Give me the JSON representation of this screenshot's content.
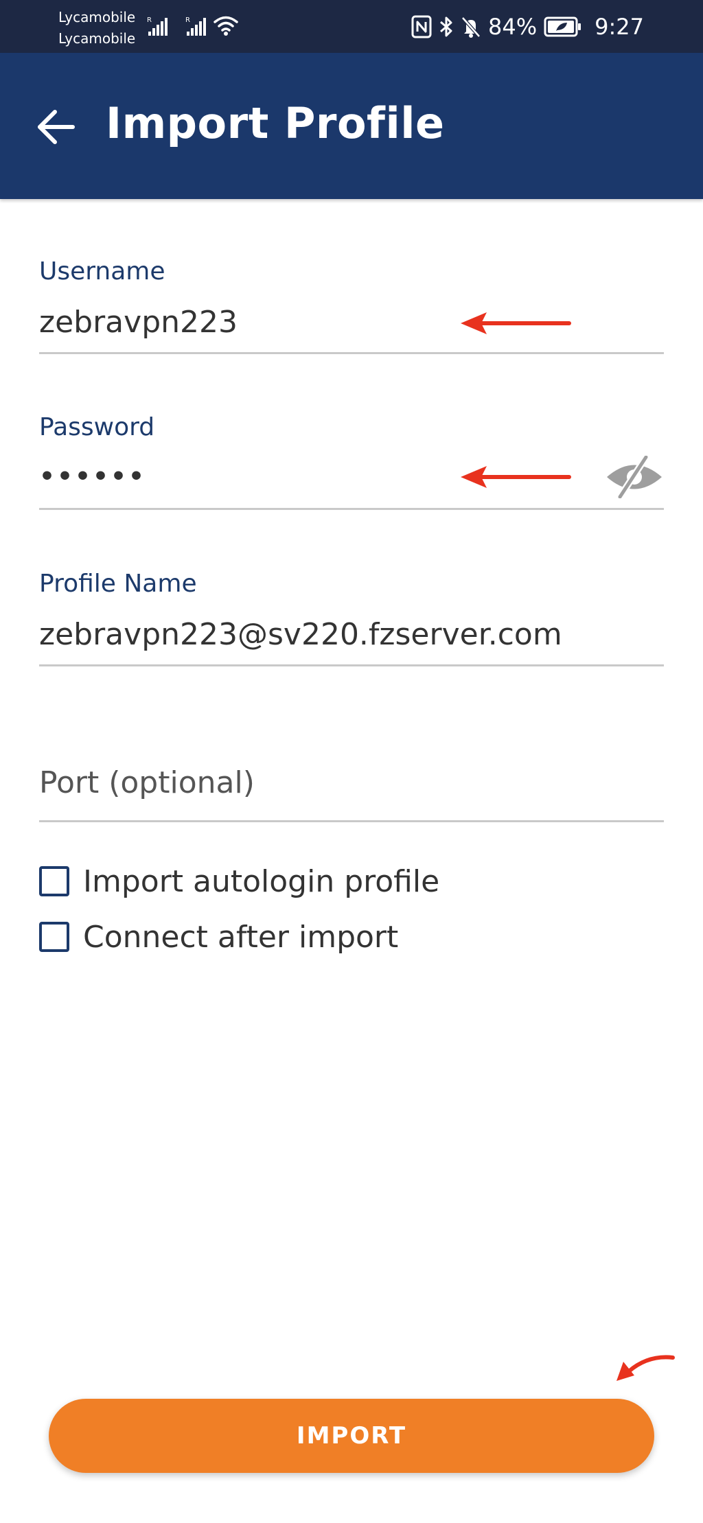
{
  "status_bar": {
    "carrier_1": "Lycamobile",
    "carrier_2": "Lycamobile",
    "roaming_indicator": "R",
    "battery_percent": "84%",
    "time": "9:27",
    "icons": [
      "signal-icon",
      "signal-icon",
      "wifi-icon",
      "nfc-icon",
      "bluetooth-icon",
      "bell-off-icon",
      "battery-icon"
    ]
  },
  "app_bar": {
    "title": "Import Profile",
    "back_icon": "arrow-back-icon",
    "background": "#1b386b"
  },
  "form": {
    "username": {
      "label": "Username",
      "value": "zebravpn223"
    },
    "password": {
      "label": "Password",
      "masked_value": "••••••",
      "toggle_icon": "eye-off-icon"
    },
    "profile_name": {
      "label": "Profile Name",
      "value": "zebravpn223@sv220.fzserver.com"
    },
    "port": {
      "placeholder": "Port (optional)",
      "value": ""
    },
    "checkboxes": [
      {
        "label": "Import autologin profile",
        "checked": false
      },
      {
        "label": "Connect after import",
        "checked": false
      }
    ]
  },
  "import_button": {
    "label": "IMPORT",
    "color": "#f07f26"
  },
  "annotations": {
    "arrow_color": "#e8321e",
    "arrows": [
      "red-arrow-icon",
      "red-arrow-icon",
      "red-arrow-icon"
    ]
  },
  "colors": {
    "accent_text": "#1c3a6b",
    "status_bar": "#1d2844"
  }
}
